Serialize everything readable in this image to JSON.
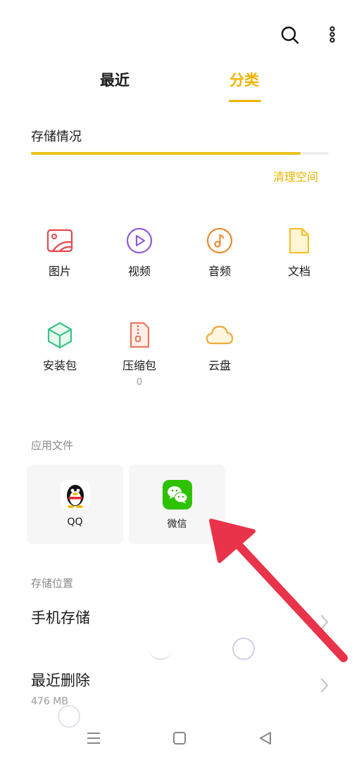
{
  "tabs": {
    "recent": "最近",
    "category": "分类"
  },
  "storage": {
    "title": "存储情况",
    "used_fraction": 0.906,
    "clean_label": "清理空间",
    "fill_color": "#e9c21a"
  },
  "categories": [
    {
      "label": "图片",
      "icon": "image-icon"
    },
    {
      "label": "视频",
      "icon": "video-icon"
    },
    {
      "label": "音频",
      "icon": "audio-icon"
    },
    {
      "label": "文档",
      "icon": "document-icon"
    },
    {
      "label": "安装包",
      "icon": "package-icon"
    },
    {
      "label": "压缩包",
      "icon": "archive-icon",
      "count": "0"
    },
    {
      "label": "云盘",
      "icon": "cloud-icon"
    }
  ],
  "app_files": {
    "title": "应用文件",
    "apps": [
      {
        "label": "QQ"
      },
      {
        "label": "微信"
      }
    ]
  },
  "storage_locations": {
    "title": "存储位置",
    "phone_storage": "手机存储",
    "recently_deleted": "最近删除",
    "recently_deleted_size": "476 MB"
  },
  "colors": {
    "accent": "#f0b400",
    "annotation_arrow": "#e8334a",
    "wechat_green": "#2dc100"
  }
}
